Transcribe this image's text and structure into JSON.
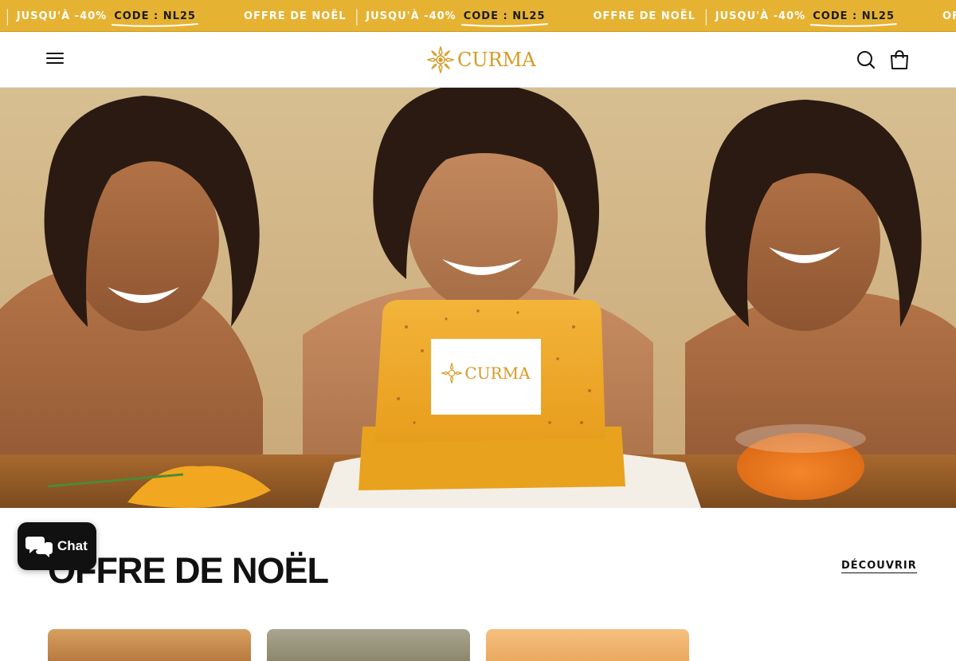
{
  "announcement": {
    "items": [
      {
        "text": "JUSQU'À -40%",
        "code": "CODE : NL25"
      },
      {
        "text": "OFFRE DE NOËL"
      },
      {
        "text": "JUSQU'À -40%",
        "code": "CODE : NL25"
      },
      {
        "text": "OFFRE DE NOËL"
      },
      {
        "text": "JUSQU'À -40%",
        "code": "CODE : NL25"
      },
      {
        "text": "OFFRE DE NOËL"
      }
    ],
    "separator": "|"
  },
  "header": {
    "logo_text": "CURMA",
    "menu_icon": "hamburger-menu-icon",
    "search_icon": "search-icon",
    "cart_icon": "shopping-bag-icon"
  },
  "hero": {
    "soap_label": "CURMA"
  },
  "section": {
    "title": "OFFRE DE NOËL",
    "link": "DÉCOUVRIR"
  },
  "chat": {
    "label": "Chat",
    "icon": "chat-bubbles-icon"
  },
  "colors": {
    "accent": "#e6b232",
    "logo": "#d69a23",
    "text": "#111111"
  }
}
